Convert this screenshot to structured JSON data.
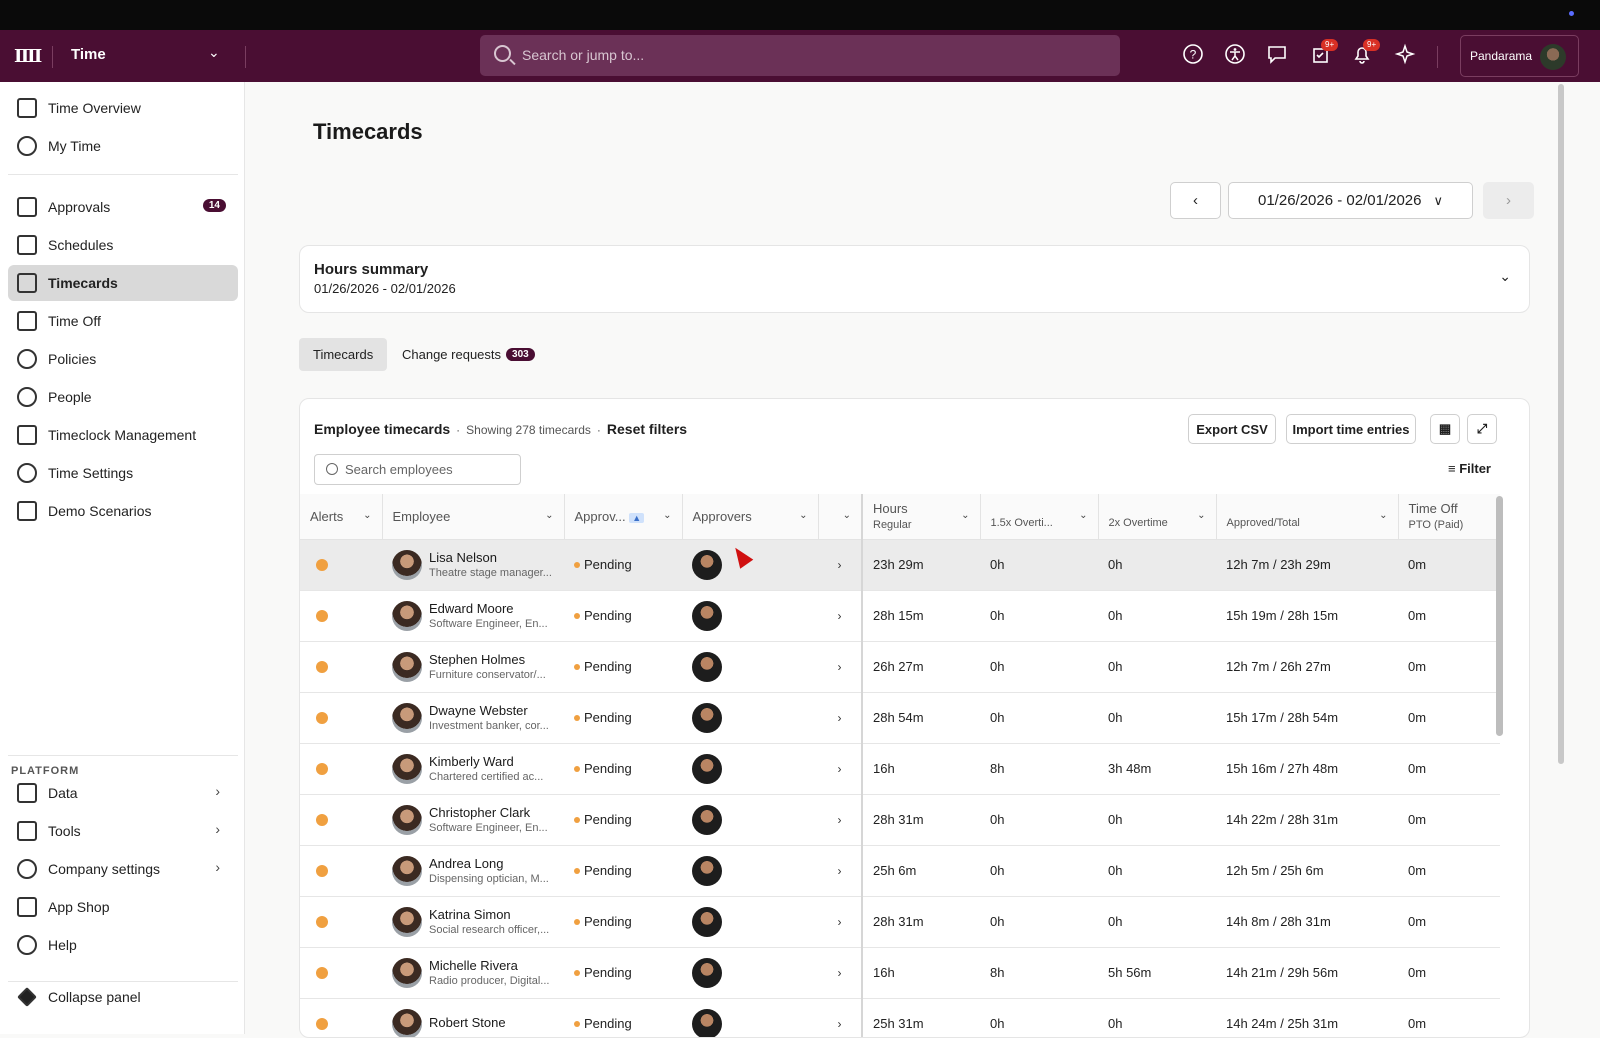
{
  "header": {
    "app_name": "Time",
    "search_placeholder": "Search or jump to...",
    "notif_badge_1": "9+",
    "notif_badge_2": "9+",
    "user_name": "Pandarama"
  },
  "sidebar": {
    "items": [
      {
        "label": "Time Overview",
        "icon": "home-chart-icon"
      },
      {
        "label": "My Time",
        "icon": "person-icon"
      },
      {
        "label": "Approvals",
        "icon": "approvals-icon",
        "count": "14"
      },
      {
        "label": "Schedules",
        "icon": "calendar-icon"
      },
      {
        "label": "Timecards",
        "icon": "timecard-icon",
        "active": true
      },
      {
        "label": "Time Off",
        "icon": "time-off-icon"
      },
      {
        "label": "Policies",
        "icon": "shield-icon"
      },
      {
        "label": "People",
        "icon": "people-icon"
      },
      {
        "label": "Timeclock Management",
        "icon": "timeclock-icon"
      },
      {
        "label": "Time Settings",
        "icon": "gear-icon"
      },
      {
        "label": "Demo Scenarios",
        "icon": "scenarios-icon"
      }
    ],
    "platform_label": "PLATFORM",
    "platform_items": [
      {
        "label": "Data",
        "icon": "database-icon"
      },
      {
        "label": "Tools",
        "icon": "toolbox-icon"
      },
      {
        "label": "Company settings",
        "icon": "company-gear-icon"
      },
      {
        "label": "App Shop",
        "icon": "app-shop-icon"
      },
      {
        "label": "Help",
        "icon": "lifebuoy-icon"
      }
    ],
    "collapse_label": "Collapse panel"
  },
  "page": {
    "title": "Timecards",
    "date_range": "01/26/2026 - 02/01/2026",
    "prev": "‹",
    "next": "›"
  },
  "hours_summary": {
    "title": "Hours summary",
    "date": "01/26/2026 - 02/01/2026"
  },
  "tabs": {
    "timecards": "Timecards",
    "change_requests": "Change requests",
    "change_requests_count": "303"
  },
  "timecards_panel": {
    "title": "Employee timecards",
    "showing": "Showing 278 timecards",
    "reset": "Reset filters",
    "export": "Export CSV",
    "import": "Import time entries",
    "search_placeholder": "Search employees",
    "filter": "Filter",
    "columns": {
      "alerts": "Alerts",
      "employee": "Employee",
      "approval": "Approv...",
      "approvers": "Approvers",
      "hours": "Hours",
      "hours_sub": "Regular",
      "ot15": "1.5x Overti...",
      "ot2": "2x Overtime",
      "approved_total": "Approved/Total",
      "timeoff": "Time Off",
      "timeoff_sub": "PTO (Paid)"
    },
    "rows": [
      {
        "name": "Lisa Nelson",
        "role": "Theatre stage manager...",
        "status": "Pending",
        "regular": "23h 29m",
        "ot15": "0h",
        "ot2": "0h",
        "approved": "12h 7m / 23h 29m",
        "pto": "0m"
      },
      {
        "name": "Edward Moore",
        "role": "Software Engineer, En...",
        "status": "Pending",
        "regular": "28h 15m",
        "ot15": "0h",
        "ot2": "0h",
        "approved": "15h 19m / 28h 15m",
        "pto": "0m"
      },
      {
        "name": "Stephen Holmes",
        "role": "Furniture conservator/...",
        "status": "Pending",
        "regular": "26h 27m",
        "ot15": "0h",
        "ot2": "0h",
        "approved": "12h 7m / 26h 27m",
        "pto": "0m"
      },
      {
        "name": "Dwayne Webster",
        "role": "Investment banker, cor...",
        "status": "Pending",
        "regular": "28h 54m",
        "ot15": "0h",
        "ot2": "0h",
        "approved": "15h 17m / 28h 54m",
        "pto": "0m"
      },
      {
        "name": "Kimberly Ward",
        "role": "Chartered certified ac...",
        "status": "Pending",
        "regular": "16h",
        "ot15": "8h",
        "ot2": "3h 48m",
        "approved": "15h 16m / 27h 48m",
        "pto": "0m"
      },
      {
        "name": "Christopher Clark",
        "role": "Software Engineer, En...",
        "status": "Pending",
        "regular": "28h 31m",
        "ot15": "0h",
        "ot2": "0h",
        "approved": "14h 22m / 28h 31m",
        "pto": "0m"
      },
      {
        "name": "Andrea Long",
        "role": "Dispensing optician, M...",
        "status": "Pending",
        "regular": "25h 6m",
        "ot15": "0h",
        "ot2": "0h",
        "approved": "12h 5m / 25h 6m",
        "pto": "0m"
      },
      {
        "name": "Katrina Simon",
        "role": "Social research officer,...",
        "status": "Pending",
        "regular": "28h 31m",
        "ot15": "0h",
        "ot2": "0h",
        "approved": "14h 8m / 28h 31m",
        "pto": "0m"
      },
      {
        "name": "Michelle Rivera",
        "role": "Radio producer, Digital...",
        "status": "Pending",
        "regular": "16h",
        "ot15": "8h",
        "ot2": "5h 56m",
        "approved": "14h 21m / 29h 56m",
        "pto": "0m"
      },
      {
        "name": "Robert Stone",
        "role": "",
        "status": "Pending",
        "regular": "25h 31m",
        "ot15": "0h",
        "ot2": "0h",
        "approved": "14h 24m / 25h 31m",
        "pto": "0m"
      }
    ]
  }
}
